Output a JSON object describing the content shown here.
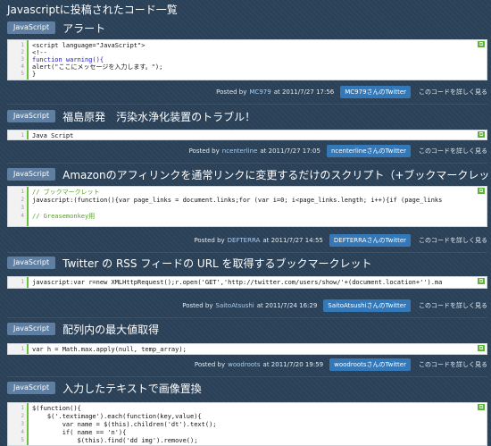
{
  "page_title": "Javascriptに投稿されたコード一覧",
  "entries": [
    {
      "tag": "JavaScript",
      "title": "アラート",
      "code": [
        "<script language=\"JavaScript\">",
        "<!--",
        "function warning(){",
        "alert(\"ここにメッセージを入力します。\");",
        "}"
      ],
      "line_numbers": [
        "1",
        "2",
        "3",
        "4",
        "5"
      ],
      "posted_by": "Posted by",
      "user": "MC979",
      "at": "at 2011/7/27 17:56",
      "twitter": "MC979さんのTwitter",
      "detail": "このコードを詳しく見る"
    },
    {
      "tag": "JavaScript",
      "title": "福島原発　汚染水浄化装置のトラブル！",
      "code": [
        "Java Script"
      ],
      "line_numbers": [
        "1"
      ],
      "posted_by": "Posted by",
      "user": "ncenterline",
      "at": "at 2011/7/27 17:05",
      "twitter": "ncenterlineさんのTwitter",
      "detail": "このコードを詳しく見る"
    },
    {
      "tag": "JavaScript",
      "title": "Amazonのアフィリンクを通常リンクに変更するだけのスクリプト（+ブックマークレット）",
      "code": [
        "// ブックマークレット",
        "javascript:(function(){var page_links = document.links;for (var i=0; i<page_links.length; i++){if (page_links",
        "",
        "// Greasemonkey用"
      ],
      "line_numbers": [
        "1",
        "2",
        "3",
        "4"
      ],
      "posted_by": "Posted by",
      "user": "DEFTERRA",
      "at": "at 2011/7/27 14:55",
      "twitter": "DEFTERRAさんのTwitter",
      "detail": "このコードを詳しく見る"
    },
    {
      "tag": "JavaScript",
      "title": "Twitter の RSS フィードの URL を取得するブックマークレット",
      "code": [
        "javascript:var r=new XMLHttpRequest();r.open('GET','http://twitter.com/users/show/'+(document.location+'').ma"
      ],
      "line_numbers": [
        "1"
      ],
      "posted_by": "Posted by",
      "user": "SaitoAtsushi",
      "at": "at 2011/7/24 16:29",
      "twitter": "SaitoAtsushiさんのTwitter",
      "detail": "このコードを詳しく見る"
    },
    {
      "tag": "JavaScript",
      "title": "配列内の最大値取得",
      "code": [
        "var h = Math.max.apply(null, temp_array);"
      ],
      "line_numbers": [
        "1"
      ],
      "posted_by": "Posted by",
      "user": "woodroots",
      "at": "at 2011/7/20 19:59",
      "twitter": "woodrootsさんのTwitter",
      "detail": "このコードを詳しく見る"
    },
    {
      "tag": "JavaScript",
      "title": "入力したテキストで画像置換",
      "code": [
        "$(function(){",
        "    $('.textimage').each(function(key,value){",
        "        var name = $(this).children('dt').text();",
        "        if( name == 'n'){",
        "            $(this).find('dd img').remove();"
      ],
      "line_numbers": [
        "1",
        "2",
        "3",
        "4",
        "5"
      ]
    }
  ],
  "copy_icon": "copy-icon",
  "colors": {
    "background": "#2a4158",
    "tag": "#5f7fa2",
    "twitter_button": "#3478b8",
    "user_link": "#a9cdf2",
    "gutter_accent": "#6cbf3b"
  }
}
